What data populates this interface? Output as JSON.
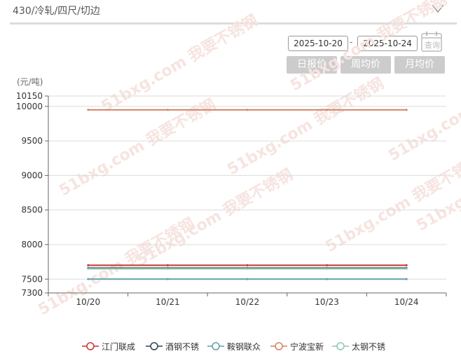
{
  "header": {
    "title": "430/冷轧/四尺/切边",
    "collapse_icon": "chevron-down-icon"
  },
  "filters": {
    "start_date": "2025-10-20",
    "end_date": "2025-10-24",
    "separator": "-",
    "query_label": "查询",
    "query_icon": "calendar-icon",
    "period_buttons": [
      "日报价",
      "周均价",
      "月均价"
    ]
  },
  "chart_data": {
    "type": "line",
    "title": "",
    "xlabel": "",
    "ylabel": "(元/吨)",
    "categories": [
      "10/20",
      "10/21",
      "10/22",
      "10/23",
      "10/24"
    ],
    "ylim": [
      7300,
      10150
    ],
    "yticks": [
      7300,
      7500,
      8000,
      8500,
      9000,
      9500,
      10000,
      10150
    ],
    "grid": true,
    "legend_position": "bottom",
    "series": [
      {
        "name": "江门联成",
        "color": "#c23531",
        "values": [
          7700,
          7700,
          7700,
          7700,
          7700
        ]
      },
      {
        "name": "酒钢不锈",
        "color": "#2f4554",
        "values": [
          7660,
          7660,
          7660,
          7660,
          7660
        ]
      },
      {
        "name": "鞍钢联众",
        "color": "#61a0a8",
        "values": [
          7500,
          7500,
          7500,
          7500,
          7500
        ]
      },
      {
        "name": "宁波宝新",
        "color": "#d48265",
        "values": [
          9950,
          9950,
          9950,
          9950,
          9950
        ]
      },
      {
        "name": "太钢不锈",
        "color": "#91c7ae",
        "values": [
          7650,
          7650,
          7650,
          7650,
          7650
        ]
      }
    ]
  },
  "watermark": "51bxg.com 我要不锈钢"
}
